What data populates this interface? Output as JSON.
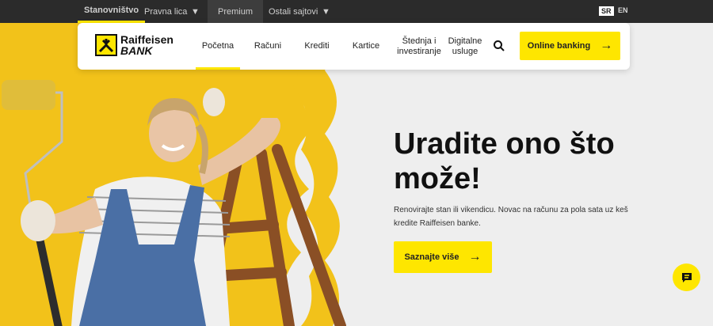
{
  "topbar": {
    "segments": [
      "Stanovništvo",
      "Pravna lica",
      "Premium",
      "Ostali sajtovi"
    ],
    "lang": {
      "active": "SR",
      "other": "EN"
    }
  },
  "logo": {
    "line1": "Raiffeisen",
    "line2": "BANK"
  },
  "nav": {
    "items": [
      "Početna",
      "Računi",
      "Krediti",
      "Kartice",
      "Štednja i investiranje",
      "Digitalne usluge"
    ],
    "online_banking": "Online banking"
  },
  "hero": {
    "title": "Uradite ono što može!",
    "text": "Renovirajte stan ili vikendicu. Novac na računu za pola sata uz keš kredite Raiffeisen banke.",
    "cta": "Saznajte više"
  },
  "colors": {
    "accent": "#fee600",
    "topbar": "#2b2b2b",
    "paint": "#f2c21a"
  },
  "icons": [
    "chevron-down-icon",
    "search-icon",
    "arrow-right-icon",
    "chat-icon"
  ]
}
